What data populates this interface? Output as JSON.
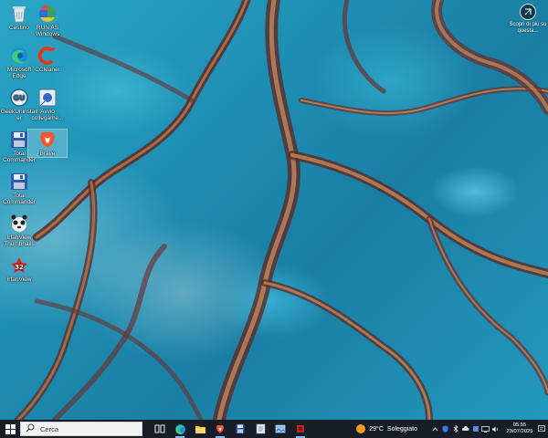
{
  "desktop_icons": [
    {
      "label": "Cestino",
      "icon": "recycle-bin-icon"
    },
    {
      "label": "Microsoft Edge",
      "icon": "edge-icon"
    },
    {
      "label": "GeekUninstaller",
      "icon": "geek-uninstaller-icon"
    },
    {
      "label": "Total Commander",
      "icon": "total-commander-icon"
    },
    {
      "label": "Total Commander",
      "icon": "total-commander-icon"
    },
    {
      "label": "IrfanView Thumbnails",
      "icon": "irfanview-thumbnails-icon"
    },
    {
      "label": "IrfanView",
      "icon": "irfanview-icon"
    },
    {
      "label": "RUN AS Windows",
      "icon": "run-as-windows-icon"
    },
    {
      "label": "CCleaner",
      "icon": "ccleaner-icon"
    },
    {
      "label": "Avvio collegame...",
      "icon": "shortcut-icon"
    },
    {
      "label": "Brave",
      "icon": "brave-icon"
    }
  ],
  "learn_more": {
    "label": "Scopri di più su questa...",
    "icon": "camera-aperture-icon"
  },
  "taskbar": {
    "search_placeholder": "Cerca",
    "apps": [
      {
        "name": "task-view",
        "icon": "task-view-icon"
      },
      {
        "name": "edge",
        "icon": "edge-icon"
      },
      {
        "name": "file-explorer",
        "icon": "folder-icon"
      },
      {
        "name": "brave",
        "icon": "brave-icon"
      },
      {
        "name": "total-commander",
        "icon": "total-commander-icon"
      },
      {
        "name": "notepad",
        "icon": "notepad-icon"
      },
      {
        "name": "photos",
        "icon": "photos-icon"
      },
      {
        "name": "app-red",
        "icon": "red-app-icon"
      }
    ],
    "weather": {
      "temp": "29°C",
      "condition": "Soleggiato"
    },
    "clock": {
      "time": "05:55",
      "date": "23/07/2025"
    }
  },
  "colors": {
    "taskbar_bg": "#161d26",
    "search_bg": "#f2f2f2",
    "accent": "#8ab4f8"
  }
}
